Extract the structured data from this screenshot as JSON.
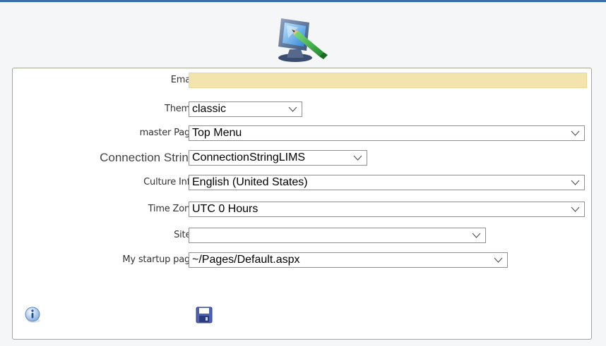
{
  "form": {
    "email": {
      "label": "Email:",
      "value": ""
    },
    "theme": {
      "label": "Theme:",
      "value": "classic"
    },
    "master_page": {
      "label": "master Page:",
      "value": "Top Menu"
    },
    "connection_string": {
      "label": "Connection String:",
      "value": "ConnectionStringLIMS"
    },
    "culture_info": {
      "label": "Culture Info:",
      "value": "English (United States)"
    },
    "time_zone": {
      "label": "Time Zone:",
      "value": "UTC 0 Hours"
    },
    "sites": {
      "label": "Sites:",
      "value": ""
    },
    "startup_page": {
      "label": "My startup page:",
      "value": "~/Pages/Default.aspx"
    }
  },
  "icons": {
    "header": "user-preferences-icon",
    "info": "info-icon",
    "save": "save-icon"
  },
  "colors": {
    "top_bar": "#3b6ea8",
    "panel_border": "#a0a890",
    "email_field": "#f3e3ad"
  }
}
